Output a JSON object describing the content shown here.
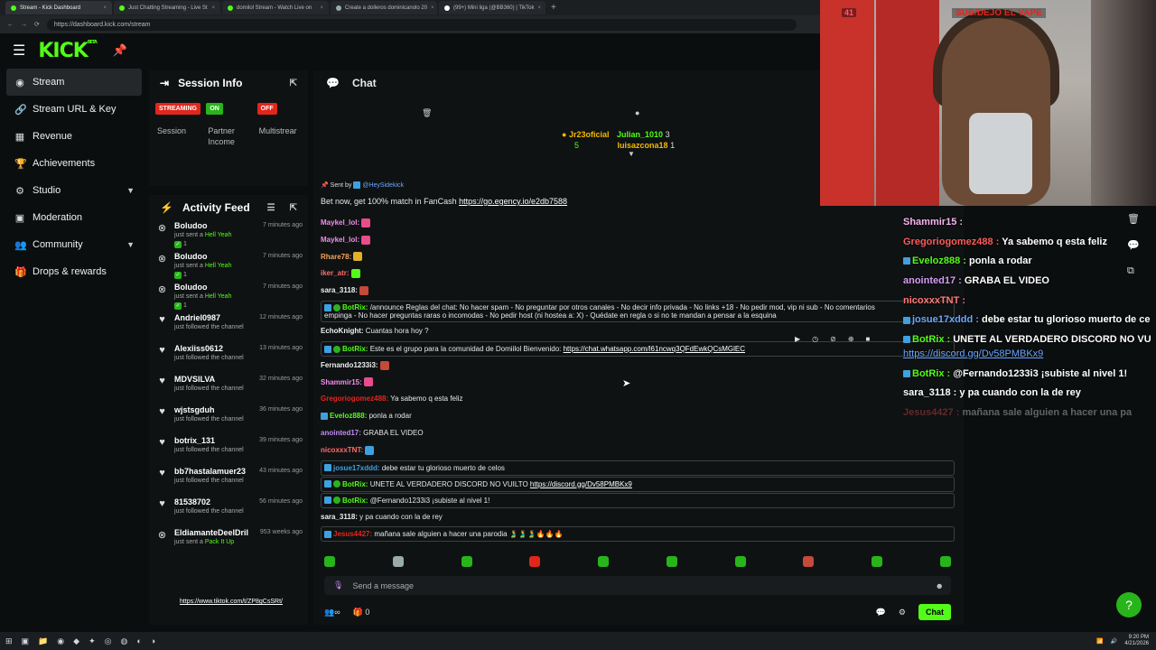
{
  "browser": {
    "tabs": [
      {
        "label": "Stream - Kick Dashboard",
        "active": true
      },
      {
        "label": "Just Chatting Streaming - Live St",
        "active": false
      },
      {
        "label": "domilol Stream - Watch Live on",
        "active": false
      },
      {
        "label": "Create a dolleros dominicanolo 20",
        "active": false
      },
      {
        "label": "(99+) Mini liga (@BB360) | TikTok",
        "active": false
      }
    ],
    "url": "https://dashboard.kick.com/stream"
  },
  "header": {
    "logo": "KICK",
    "logo_sup": "BETA"
  },
  "sidebar": {
    "items": [
      {
        "label": "Stream",
        "icon": "broadcast-icon"
      },
      {
        "label": "Stream URL & Key",
        "icon": "link-icon"
      },
      {
        "label": "Revenue",
        "icon": "revenue-icon"
      },
      {
        "label": "Achievements",
        "icon": "achievements-icon"
      },
      {
        "label": "Studio",
        "icon": "studio-icon"
      },
      {
        "label": "Moderation",
        "icon": "moderation-icon"
      },
      {
        "label": "Community",
        "icon": "community-icon"
      },
      {
        "label": "Drops & rewards",
        "icon": "gift-icon"
      }
    ]
  },
  "session": {
    "title": "Session Info",
    "cards": [
      {
        "badge": "STREAMING",
        "label": "Session"
      },
      {
        "badge": "ON",
        "label": "Partner Income"
      },
      {
        "badge": "OFF",
        "label": "Multistrear"
      }
    ]
  },
  "activity": {
    "title": "Activity Feed",
    "items": [
      {
        "name": "Boludoo",
        "sub": "just sent a",
        "gift": "Hell Yeah",
        "extra": "1",
        "time": "7 minutes ago",
        "type": "gift"
      },
      {
        "name": "Boludoo",
        "sub": "just sent a",
        "gift": "Hell Yeah",
        "extra": "1",
        "time": "7 minutes ago",
        "type": "gift"
      },
      {
        "name": "Boludoo",
        "sub": "just sent a",
        "gift": "Hell Yeah",
        "extra": "1",
        "time": "7 minutes ago",
        "type": "gift"
      },
      {
        "name": "Andriel0987",
        "sub": "just followed the channel",
        "time": "12 minutes ago",
        "type": "follow"
      },
      {
        "name": "Alexiiss0612",
        "sub": "just followed the channel",
        "time": "13 minutes ago",
        "type": "follow"
      },
      {
        "name": "MDVSILVA",
        "sub": "just followed the channel",
        "time": "32 minutes ago",
        "type": "follow"
      },
      {
        "name": "wjstsgduh",
        "sub": "just followed the channel",
        "time": "36 minutes ago",
        "type": "follow"
      },
      {
        "name": "botrix_131",
        "sub": "just followed the channel",
        "time": "39 minutes ago",
        "type": "follow"
      },
      {
        "name": "bb7hastalamuer23",
        "sub": "just followed the channel",
        "time": "43 minutes ago",
        "type": "follow"
      },
      {
        "name": "81538702",
        "sub": "just followed the channel",
        "time": "56 minutes ago",
        "type": "follow"
      },
      {
        "name": "EldiamanteDeelDril",
        "sub": "just sent a",
        "gift": "Pack It Up",
        "time": "953 weeks ago",
        "type": "gift"
      }
    ],
    "tiktok_link": "https://www.tiktok.com/t/ZP8gCsSRt/"
  },
  "chat": {
    "title": "Chat",
    "gifters": {
      "first": {
        "name": "Jr23oficial",
        "count": "5"
      },
      "second": {
        "name": "Julian_1010",
        "count": "3"
      },
      "third": {
        "name": "luisazcona18",
        "count": "1"
      }
    },
    "pinned": {
      "sent_by": "Sent by",
      "sender": "@HeySidekick",
      "text": "Bet now, get 100% match in FanCash",
      "link": "https://go.egency.io/e2db7588"
    },
    "messages": [
      {
        "user": "Maykel_lol:",
        "text": "",
        "color": "#f08ee8",
        "emote": "#e74c8c"
      },
      {
        "user": "Maykel_lol:",
        "text": "",
        "color": "#f08ee8",
        "emote": "#e74c8c"
      },
      {
        "user": "Rhare78:",
        "text": "",
        "color": "#f6a35b",
        "emote": "#e0b02a"
      },
      {
        "user": "iker_atr:",
        "text": "",
        "color": "#ff6b6b",
        "emote": "#53fc18"
      },
      {
        "user": "sara_3118:",
        "text": "",
        "color": "#f0f0f0",
        "emote": "#c44a3a"
      },
      {
        "user": "BotRix:",
        "text": "/announce Reglas del chat: No hacer spam - No preguntar por otros canales - No decir info privada - No links +18 - No pedir mod, vip ni sub - No comentarios",
        "text2": "empinga - No hacer preguntas raras o incomodas - No pedir host (ni hostea a: X) - Quédate en regla o si no te mandan a pensar a la esquina",
        "bot": true,
        "boxed": true
      },
      {
        "user": "EchoKnight:",
        "text": "Cuantas hora hoy ?",
        "color": "#f0f0f0"
      },
      {
        "user": "BotRix:",
        "text": "Este es el grupo para la comunidad de Domiilol Bienvenido:",
        "link": "https://chat.whatsapp.com/l61ncwq3QFdEwkQCsMGlEC",
        "bot": true,
        "boxed": true
      },
      {
        "user": "Fernando1233i3:",
        "text": "",
        "color": "#f0f0f0",
        "emote": "#c44a3a"
      },
      {
        "user": "Shammir15:",
        "text": "",
        "color": "#f08ee8",
        "emote": "#e74c8c"
      },
      {
        "user": "Gregoriogomez488:",
        "text": "Ya sabemo q esta feliz",
        "color": "#e1261c"
      },
      {
        "user": "Eveloz888:",
        "text": "ponla a rodar",
        "color": "#53fc18",
        "badge": true
      },
      {
        "user": "anointed17:",
        "text": "GRABA EL VIDEO",
        "color": "#c08cf0"
      },
      {
        "user": "nicoxxxTNT:",
        "text": "",
        "color": "#ff6b6b",
        "emote": "#3fa0e0"
      },
      {
        "user": "josue17xddd:",
        "text": "debe estar tu glorioso muerto de celos",
        "color": "#3fa0e0",
        "badge": true,
        "boxed": true
      },
      {
        "user": "BotRix:",
        "text": "UNETE AL VERDADERO DISCORD NO VUILTO",
        "link": "https://discord.gg/Dv58PMBKx9",
        "bot": true,
        "boxed": true
      },
      {
        "user": "BotRix:",
        "text": "@Fernando1233i3 ¡subiste al nivel 1!",
        "bot": true,
        "boxed": true
      },
      {
        "user": "sara_3118:",
        "text": "y pa cuando con la de rey",
        "color": "#f0f0f0"
      },
      {
        "user": "Jesus4427:",
        "text": "mañana sale alguien a hacer una parodia 🫃🫃🫃🔥🔥🔥",
        "color": "#e1261c",
        "badge": true,
        "boxed": true
      }
    ],
    "send_placeholder": "Send a message",
    "footer": {
      "points": "0",
      "chat_button": "Chat"
    }
  },
  "overlay": {
    "cam_count": "41",
    "cam_title": "SUB/DEJO EL VAPE",
    "messages": [
      {
        "user": "Shammir15 :",
        "text": "",
        "color": "#f6b5f0"
      },
      {
        "user": "Gregoriogomez488 :",
        "text": "Ya sabemo q esta feliz",
        "color": "#ff5a5a"
      },
      {
        "user": "Eveloz888 :",
        "text": "ponla a rodar",
        "color": "#53fc18",
        "badge": true
      },
      {
        "user": "anointed17 :",
        "text": "GRABA EL VIDEO",
        "color": "#d49cf5"
      },
      {
        "user": "nicoxxxTNT :",
        "text": "",
        "color": "#ff7a7a"
      },
      {
        "user": "josue17xddd :",
        "text": "debe estar tu glorioso muerto de ce",
        "color": "#6aa7ff",
        "badge": true
      },
      {
        "user": "BotRix :",
        "text": "UNETE AL VERDADERO DISCORD NO VU",
        "color": "#53fc18",
        "badge": true
      },
      {
        "user": "",
        "text": "https://discord.gg/Dv58PMBKx9",
        "link": true
      },
      {
        "user": "BotRix :",
        "text": "@Fernando1233i3 ¡subiste al nivel 1!",
        "color": "#53fc18",
        "badge": true
      },
      {
        "user": "sara_3118 :",
        "text": "y pa cuando con la de rey",
        "color": "#ffffff"
      },
      {
        "user": "Jesus4427 :",
        "text": "mañana sale alguien a hacer una pa",
        "color": "#ff5a5a",
        "faded": true
      }
    ]
  },
  "taskbar": {
    "time": "9:20 PM",
    "date": "4/21/2026"
  }
}
